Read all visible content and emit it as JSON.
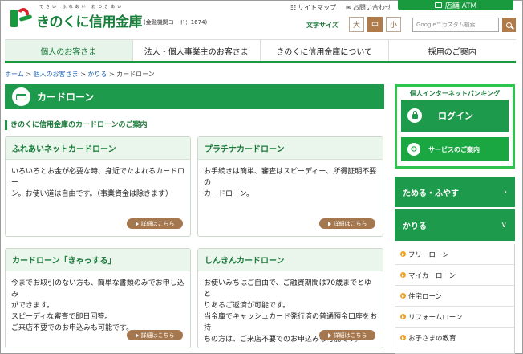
{
  "header": {
    "logo_kana": "できい ふれあい おつきあい",
    "logo_name": "きのくに信用金庫",
    "logo_code": "(金融機関コード：1674)",
    "top_links": [
      {
        "icon": "sitemap-icon",
        "label": "サイトマップ"
      },
      {
        "icon": "mail-icon",
        "label": "お問い合わせ"
      }
    ],
    "atm_label": "店舗 ATM",
    "font_size_label": "文字サイズ",
    "font_sizes": [
      "大",
      "中",
      "小"
    ],
    "font_size_selected": "中",
    "search_placeholder": "Google™カスタム検索"
  },
  "nav": {
    "tabs": [
      {
        "label": "個人のお客さま",
        "active": true
      },
      {
        "label": "法人・個人事業主のお客さま",
        "active": false
      },
      {
        "label": "きのくに信用金庫について",
        "active": false
      },
      {
        "label": "採用のご案内",
        "active": false
      }
    ]
  },
  "breadcrumb": {
    "items": [
      "ホーム",
      "個人のお客さま",
      "かりる",
      "カードローン"
    ],
    "separator": ">"
  },
  "page": {
    "title": "カードローン",
    "subheading": "きのくに信用金庫のカードローンのご案内"
  },
  "cards": [
    {
      "title": "ふれあいネットカードローン",
      "body": [
        "いろいろとお金が必要な時、身近でたよれるカードロー",
        "ン。お使い道は自由です。（事業資金は除きます）"
      ],
      "more": "詳細はこちら"
    },
    {
      "title": "プラチナカードローン",
      "body": [
        "お手続きは簡単、審査はスピーディー、所得証明不要の",
        "カードローン。"
      ],
      "more": "詳細はこちら"
    },
    {
      "title": "カードローン「きゃっする」",
      "body": [
        "今までお取引のない方も、簡単な書類のみでお申し込み",
        "ができます。",
        "スピーディな審査で即日回答。",
        "ご来店不要でのお申込みも可能です。"
      ],
      "more": "詳細はこちら"
    },
    {
      "title": "しんきんカードローン",
      "body": [
        "お使いみちはご自由で、ご融資期間は70歳までとゆと",
        "りあるご返済が可能です。",
        "当金庫でキャッシュカード発行済の普通預金口座をお持",
        "ちの方は、ご来店不要でのお申込みも可能です。"
      ],
      "more": "詳細はこちら"
    }
  ],
  "sidebar": {
    "ib_title": "個人インターネットバンキング",
    "login": "ログイン",
    "service": "サービスのご案内",
    "accordions": [
      {
        "label": "ためる・ふやす",
        "chevron": "›"
      },
      {
        "label": "かりる",
        "chevron": "∨"
      }
    ],
    "items": [
      "フリーローン",
      "マイカーローン",
      "住宅ローン",
      "リフォームローン",
      "お子さまの教育"
    ]
  },
  "colors": {
    "brand_green": "#1e9a4c",
    "accent_brown": "#a5774e",
    "link_blue": "#2062b0",
    "bullet_orange": "#f2a024"
  }
}
